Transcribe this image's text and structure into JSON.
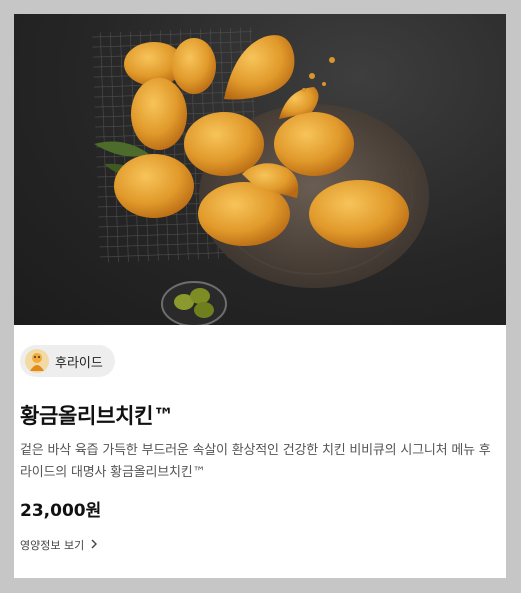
{
  "product": {
    "category_tag": "후라이드",
    "name": "황금올리브치킨™",
    "description": "겉은 바삭 육즙 가득한 부드러운 속살이 환상적인 건강한 치킨 비비큐의 시그니처 메뉴 후라이드의 대명사 황금올리브치킨™",
    "price": "23,000원",
    "nutrition_link": "영양정보 보기"
  },
  "icons": {
    "tag_avatar": "chicken-mascot-icon",
    "nutrition_chevron": "chevron-right-icon"
  },
  "colors": {
    "background": "#c6c6c6",
    "card": "#ffffff",
    "tag_bg": "#eeeeee",
    "title": "#111111",
    "description": "#555555"
  }
}
